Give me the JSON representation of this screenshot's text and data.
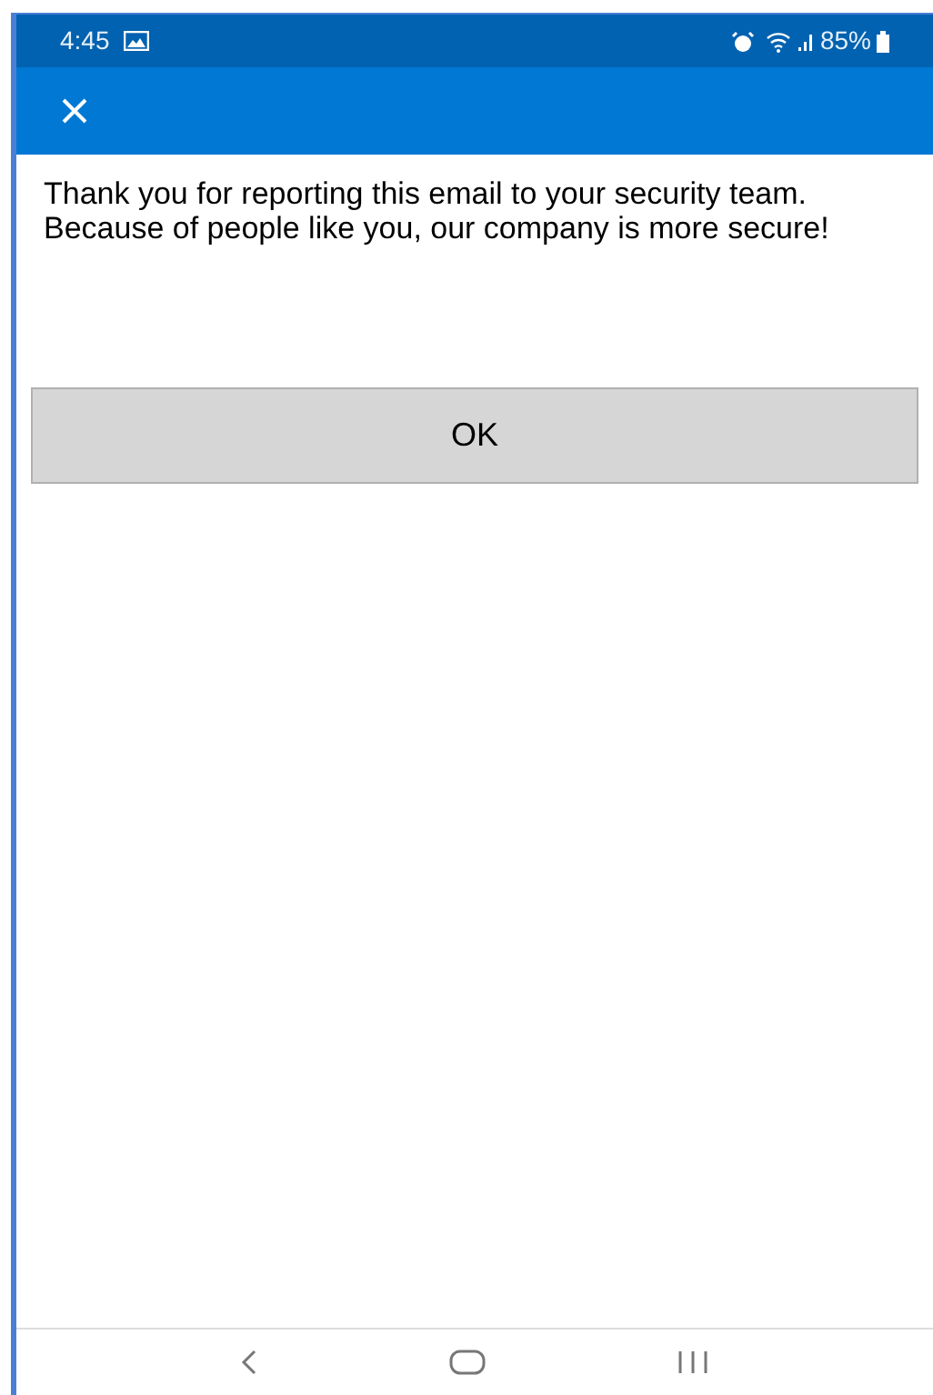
{
  "status_bar": {
    "time": "4:45",
    "battery": "85%"
  },
  "message": "Thank you for reporting this email to your security team. Because of people like you, our company is more secure!",
  "button": {
    "label": "OK"
  }
}
